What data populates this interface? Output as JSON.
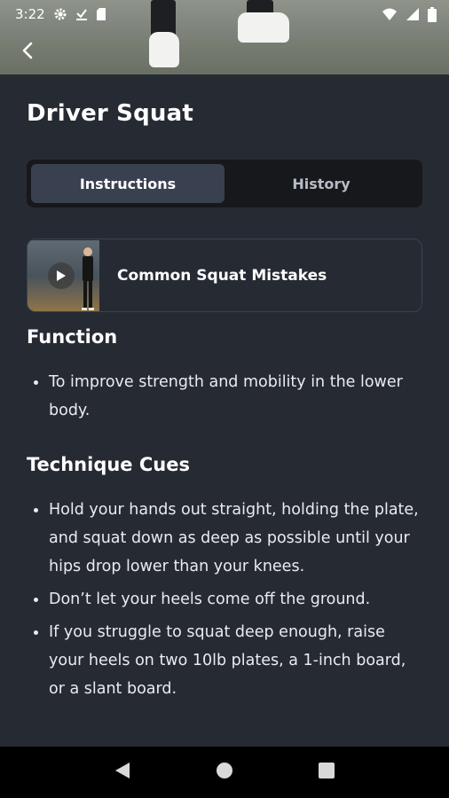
{
  "status_bar": {
    "time": "3:22",
    "left_icons": [
      "settings-icon",
      "download-done-icon",
      "sd-card-icon"
    ],
    "right_icons": [
      "wifi-icon",
      "cellular-signal-icon",
      "battery-icon"
    ]
  },
  "header": {
    "back_icon": "chevron-left-icon",
    "title": "Driver Squat"
  },
  "tabs": [
    {
      "label": "Instructions",
      "active": true
    },
    {
      "label": "History",
      "active": false
    }
  ],
  "video": {
    "title": "Common Squat Mistakes",
    "icon": "play-icon"
  },
  "function": {
    "heading": "Function",
    "items": [
      "To improve strength and mobility in the lower body."
    ]
  },
  "technique": {
    "heading": "Technique Cues",
    "items": [
      "Hold your hands out straight, holding the plate, and squat down as deep as possible until your hips drop lower than your knees.",
      "Don’t let your heels come off the ground.",
      "If you struggle to squat deep enough, raise your heels on two 10lb plates, a 1-inch board, or a slant board."
    ]
  },
  "nav_bar": {
    "icons": [
      "back-triangle-icon",
      "home-circle-icon",
      "recents-square-icon"
    ]
  },
  "colors": {
    "background": "#262a33",
    "tab_active": "#394150",
    "tab_track": "#16181c"
  }
}
